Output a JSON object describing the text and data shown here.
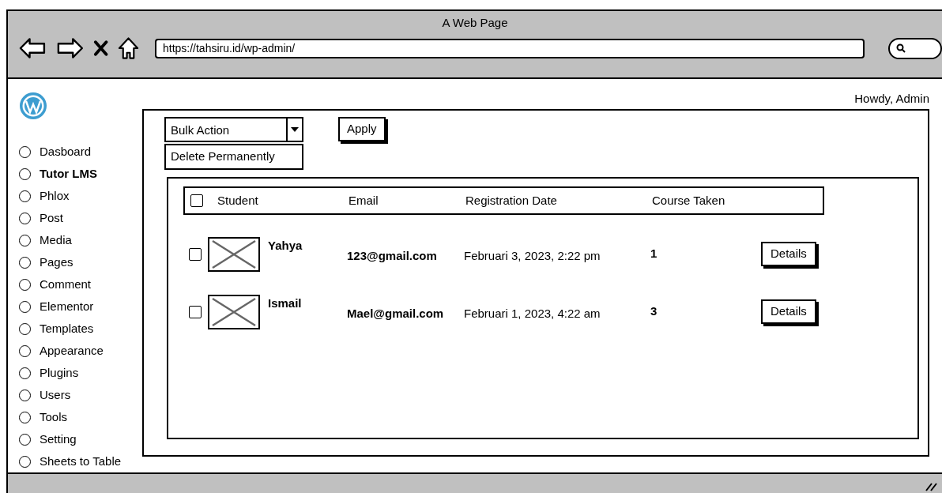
{
  "window": {
    "title": "A Web Page"
  },
  "address_bar": {
    "value": "https://tahsiru.id/wp-admin/"
  },
  "greeting": "Howdy, Admin",
  "sidebar": {
    "items": [
      {
        "label": "Dasboard",
        "selected": false
      },
      {
        "label": "Tutor LMS",
        "selected": true
      },
      {
        "label": "Phlox",
        "selected": false
      },
      {
        "label": "Post",
        "selected": false
      },
      {
        "label": "Media",
        "selected": false
      },
      {
        "label": "Pages",
        "selected": false
      },
      {
        "label": "Comment",
        "selected": false
      },
      {
        "label": "Elementor",
        "selected": false
      },
      {
        "label": "Templates",
        "selected": false
      },
      {
        "label": "Appearance",
        "selected": false
      },
      {
        "label": "Plugins",
        "selected": false
      },
      {
        "label": "Users",
        "selected": false
      },
      {
        "label": "Tools",
        "selected": false
      },
      {
        "label": "Setting",
        "selected": false
      },
      {
        "label": "Sheets to Table",
        "selected": false
      }
    ]
  },
  "bulk_action": {
    "value": "Bulk Action",
    "expanded": true,
    "options": [
      "Delete Permanently"
    ]
  },
  "apply_button": "Apply",
  "table": {
    "select_all_checked": false,
    "columns": [
      "Student",
      "Email",
      "Registration Date",
      "Course Taken"
    ],
    "rows": [
      {
        "checked": false,
        "student": "Yahya",
        "email": "123@gmail.com",
        "registration_date": "Februari 3, 2023, 2:22 pm",
        "course_taken": "1",
        "action": "Details"
      },
      {
        "checked": false,
        "student": "Ismail",
        "email": "Mael@gmail.com",
        "registration_date": "Februari 1, 2023, 4:22 am",
        "course_taken": "3",
        "action": "Details"
      }
    ]
  }
}
